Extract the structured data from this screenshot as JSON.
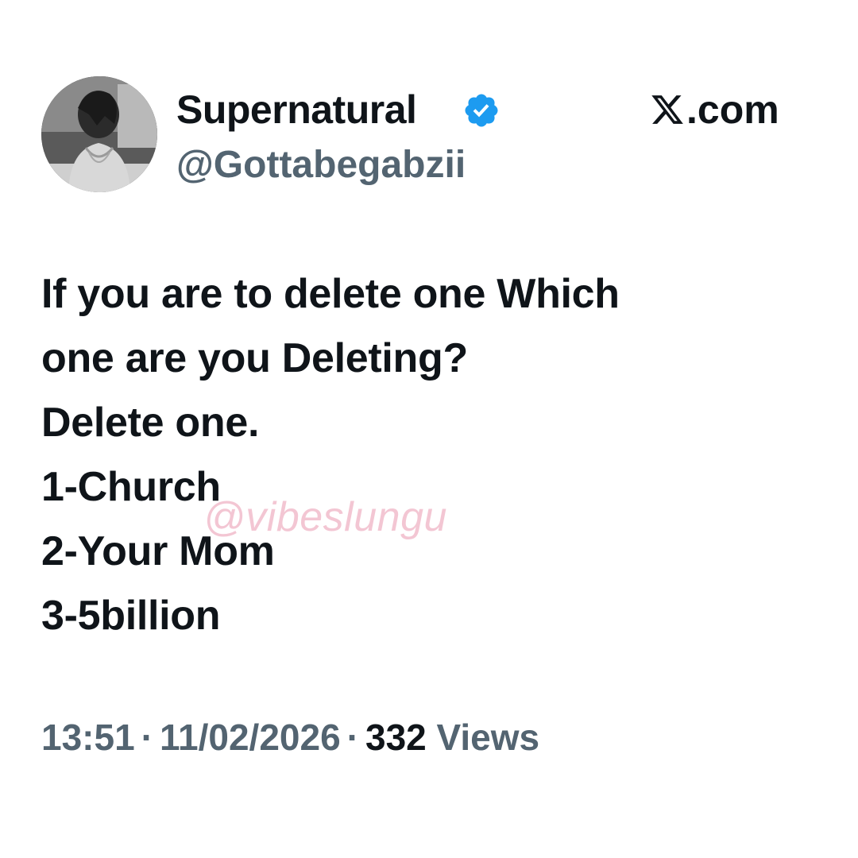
{
  "author": {
    "display_name": "Supernatural",
    "handle": "@Gottabegabzii",
    "verified_icon": "verified-badge-icon",
    "verified_color": "#1d9bf0"
  },
  "brand": {
    "logo_icon": "x-logo-icon",
    "suffix": ".com"
  },
  "tweet": {
    "lines": [
      "If you are to delete one Which",
      "one are you Deleting?",
      "Delete one.",
      "1-Church",
      "2-Your Mom",
      "3-5billion"
    ]
  },
  "watermark": "@vibeslungu",
  "meta": {
    "time": "13:51",
    "separator": "·",
    "date": "11/02/2026",
    "views_count": "332",
    "views_label": "Views"
  },
  "colors": {
    "text_primary": "#0f1419",
    "text_secondary": "#536471",
    "background": "#ffffff"
  }
}
